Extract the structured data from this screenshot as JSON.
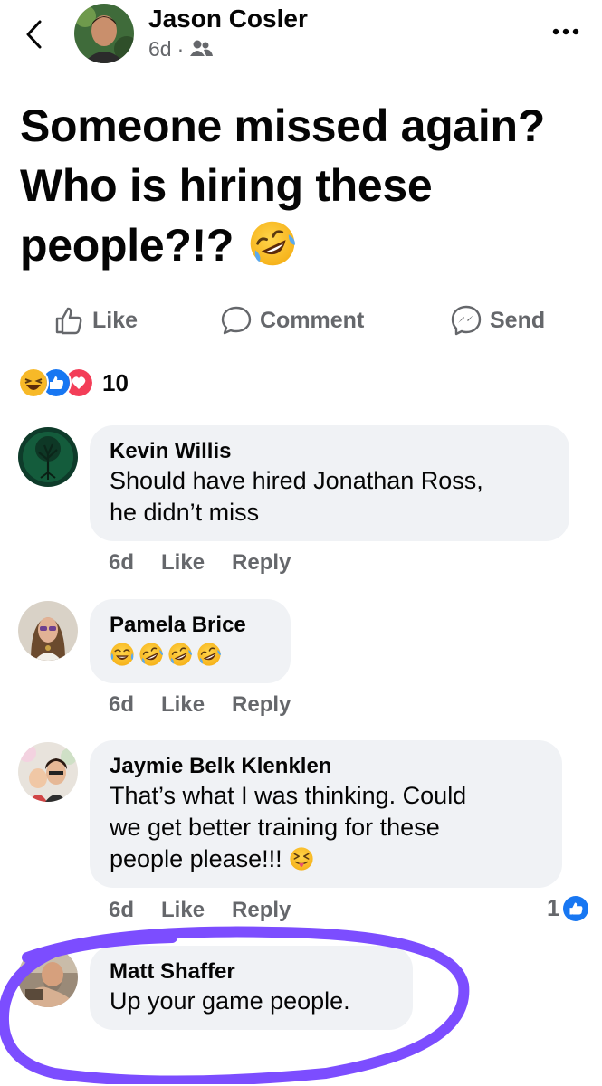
{
  "header": {
    "author": "Jason Cosler",
    "time": "6d",
    "separator": "·",
    "audience_icon": "friends-icon"
  },
  "post": {
    "text": "Someone missed again? Who is hiring these people?!?",
    "emoji": "rolling-on-floor-laughing-emoji"
  },
  "actions": {
    "like": "Like",
    "comment": "Comment",
    "send": "Send"
  },
  "reactions": {
    "types": [
      "haha",
      "like",
      "love"
    ],
    "count": "10"
  },
  "comments": [
    {
      "name": "Kevin Willis",
      "text_lines": [
        "Should have hired Jonathan Ross,",
        "he didn’t miss"
      ],
      "time": "6d",
      "like": "Like",
      "reply": "Reply"
    },
    {
      "name": "Pamela Brice",
      "emojis": [
        "face-with-tears-of-joy-emoji",
        "rolling-on-floor-laughing-emoji",
        "rolling-on-floor-laughing-emoji",
        "rolling-on-floor-laughing-emoji"
      ],
      "time": "6d",
      "like": "Like",
      "reply": "Reply"
    },
    {
      "name": "Jaymie Belk Klenklen",
      "text_lines": [
        "That’s what I was thinking. Could",
        "we get better training for these",
        "people please!!!"
      ],
      "emoji": "squinting-face-with-tongue-emoji",
      "time": "6d",
      "like": "Like",
      "reply": "Reply",
      "like_count": "1"
    },
    {
      "name": "Matt Shaffer",
      "text_lines": [
        "Up your game people."
      ]
    }
  ],
  "colors": {
    "brand_blue": "#1877f2",
    "bubble_bg": "#f0f2f5",
    "muted_text": "#65676b",
    "highlight_purple": "#7c4dff"
  }
}
